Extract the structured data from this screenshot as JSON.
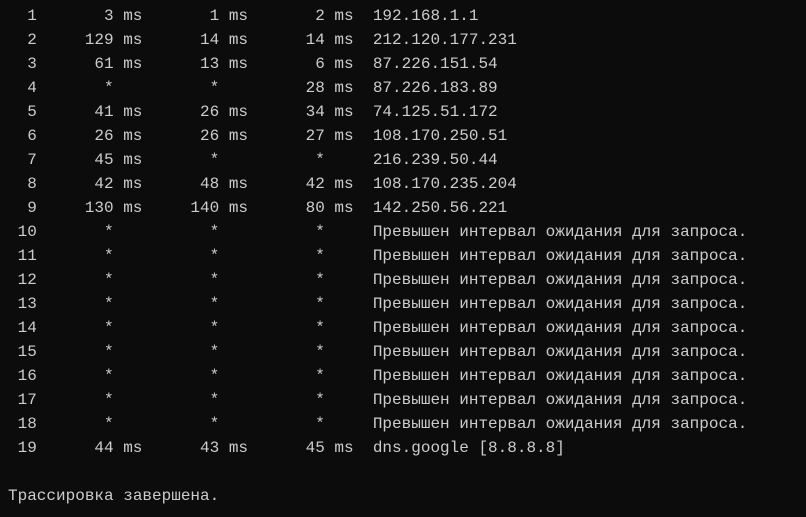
{
  "hops": [
    {
      "num": "1",
      "rtt1": "3",
      "unit1": "ms",
      "rtt2": "1",
      "unit2": "ms",
      "rtt3": "2",
      "unit3": "ms",
      "host": "192.168.1.1"
    },
    {
      "num": "2",
      "rtt1": "129",
      "unit1": "ms",
      "rtt2": "14",
      "unit2": "ms",
      "rtt3": "14",
      "unit3": "ms",
      "host": "212.120.177.231"
    },
    {
      "num": "3",
      "rtt1": "61",
      "unit1": "ms",
      "rtt2": "13",
      "unit2": "ms",
      "rtt3": "6",
      "unit3": "ms",
      "host": "87.226.151.54"
    },
    {
      "num": "4",
      "rtt1": "*",
      "unit1": "",
      "rtt2": "*",
      "unit2": "",
      "rtt3": "28",
      "unit3": "ms",
      "host": "87.226.183.89"
    },
    {
      "num": "5",
      "rtt1": "41",
      "unit1": "ms",
      "rtt2": "26",
      "unit2": "ms",
      "rtt3": "34",
      "unit3": "ms",
      "host": "74.125.51.172"
    },
    {
      "num": "6",
      "rtt1": "26",
      "unit1": "ms",
      "rtt2": "26",
      "unit2": "ms",
      "rtt3": "27",
      "unit3": "ms",
      "host": "108.170.250.51"
    },
    {
      "num": "7",
      "rtt1": "45",
      "unit1": "ms",
      "rtt2": "*",
      "unit2": "",
      "rtt3": "*",
      "unit3": "",
      "host": "216.239.50.44"
    },
    {
      "num": "8",
      "rtt1": "42",
      "unit1": "ms",
      "rtt2": "48",
      "unit2": "ms",
      "rtt3": "42",
      "unit3": "ms",
      "host": "108.170.235.204"
    },
    {
      "num": "9",
      "rtt1": "130",
      "unit1": "ms",
      "rtt2": "140",
      "unit2": "ms",
      "rtt3": "80",
      "unit3": "ms",
      "host": "142.250.56.221"
    },
    {
      "num": "10",
      "rtt1": "*",
      "unit1": "",
      "rtt2": "*",
      "unit2": "",
      "rtt3": "*",
      "unit3": "",
      "host": "Превышен интервал ожидания для запроса."
    },
    {
      "num": "11",
      "rtt1": "*",
      "unit1": "",
      "rtt2": "*",
      "unit2": "",
      "rtt3": "*",
      "unit3": "",
      "host": "Превышен интервал ожидания для запроса."
    },
    {
      "num": "12",
      "rtt1": "*",
      "unit1": "",
      "rtt2": "*",
      "unit2": "",
      "rtt3": "*",
      "unit3": "",
      "host": "Превышен интервал ожидания для запроса."
    },
    {
      "num": "13",
      "rtt1": "*",
      "unit1": "",
      "rtt2": "*",
      "unit2": "",
      "rtt3": "*",
      "unit3": "",
      "host": "Превышен интервал ожидания для запроса."
    },
    {
      "num": "14",
      "rtt1": "*",
      "unit1": "",
      "rtt2": "*",
      "unit2": "",
      "rtt3": "*",
      "unit3": "",
      "host": "Превышен интервал ожидания для запроса."
    },
    {
      "num": "15",
      "rtt1": "*",
      "unit1": "",
      "rtt2": "*",
      "unit2": "",
      "rtt3": "*",
      "unit3": "",
      "host": "Превышен интервал ожидания для запроса."
    },
    {
      "num": "16",
      "rtt1": "*",
      "unit1": "",
      "rtt2": "*",
      "unit2": "",
      "rtt3": "*",
      "unit3": "",
      "host": "Превышен интервал ожидания для запроса."
    },
    {
      "num": "17",
      "rtt1": "*",
      "unit1": "",
      "rtt2": "*",
      "unit2": "",
      "rtt3": "*",
      "unit3": "",
      "host": "Превышен интервал ожидания для запроса."
    },
    {
      "num": "18",
      "rtt1": "*",
      "unit1": "",
      "rtt2": "*",
      "unit2": "",
      "rtt3": "*",
      "unit3": "",
      "host": "Превышен интервал ожидания для запроса."
    },
    {
      "num": "19",
      "rtt1": "44",
      "unit1": "ms",
      "rtt2": "43",
      "unit2": "ms",
      "rtt3": "45",
      "unit3": "ms",
      "host": "dns.google [8.8.8.8]"
    }
  ],
  "footer": "Трассировка завершена."
}
